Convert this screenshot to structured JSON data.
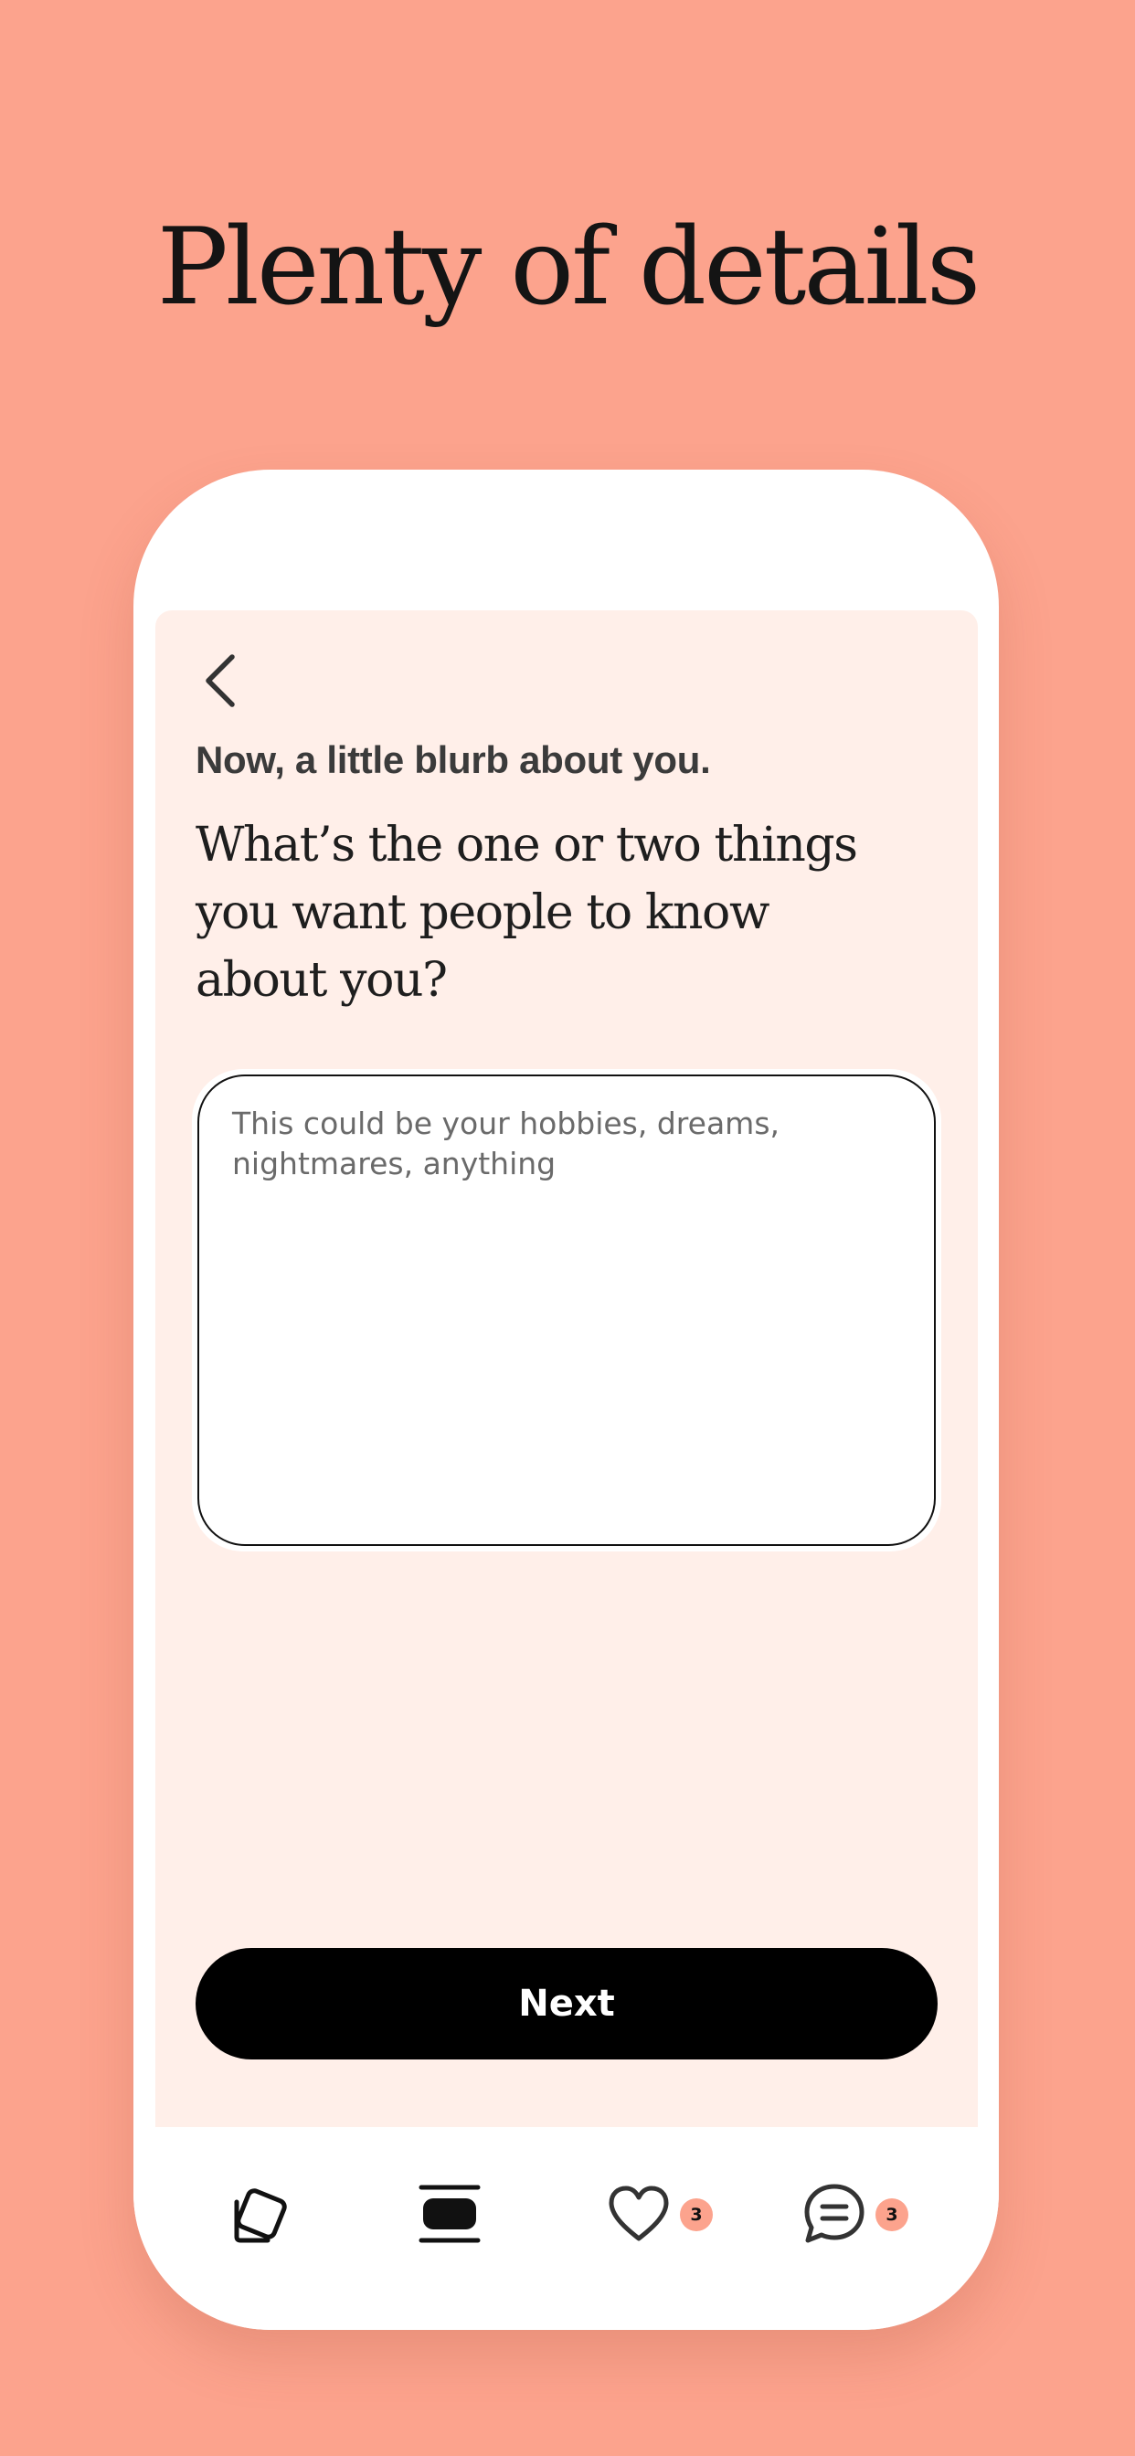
{
  "promo": {
    "headline": "Plenty of details",
    "background_color": "#FCA38D"
  },
  "screen": {
    "back_icon": "chevron-left-icon",
    "eyebrow": "Now, a little blurb about you.",
    "question": "What’s the one or two things you want people to know about you?",
    "textarea": {
      "value": "",
      "placeholder": "This could be your hobbies, dreams, nightmares, anything"
    },
    "next_label": "Next",
    "background_color": "#FFEFE9"
  },
  "tabbar": {
    "items": [
      {
        "name": "discover",
        "icon": "cards-icon",
        "badge": ""
      },
      {
        "name": "standouts",
        "icon": "standouts-icon",
        "badge": ""
      },
      {
        "name": "likes",
        "icon": "heart-icon",
        "badge": "3"
      },
      {
        "name": "messages",
        "icon": "chat-bubble-icon",
        "badge": "3"
      }
    ],
    "badge_color": "#FCA38D"
  }
}
